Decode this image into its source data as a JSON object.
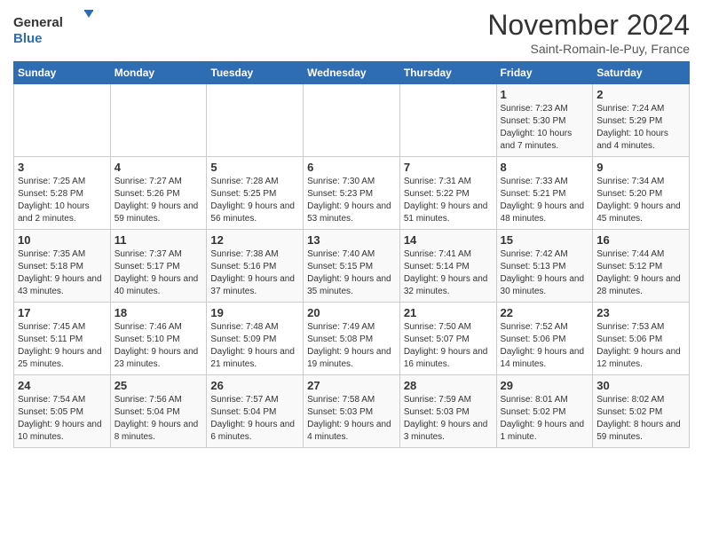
{
  "header": {
    "logo_general": "General",
    "logo_blue": "Blue",
    "month_title": "November 2024",
    "subtitle": "Saint-Romain-le-Puy, France"
  },
  "weekdays": [
    "Sunday",
    "Monday",
    "Tuesday",
    "Wednesday",
    "Thursday",
    "Friday",
    "Saturday"
  ],
  "weeks": [
    [
      {
        "day": "",
        "info": ""
      },
      {
        "day": "",
        "info": ""
      },
      {
        "day": "",
        "info": ""
      },
      {
        "day": "",
        "info": ""
      },
      {
        "day": "",
        "info": ""
      },
      {
        "day": "1",
        "info": "Sunrise: 7:23 AM\nSunset: 5:30 PM\nDaylight: 10 hours and 7 minutes."
      },
      {
        "day": "2",
        "info": "Sunrise: 7:24 AM\nSunset: 5:29 PM\nDaylight: 10 hours and 4 minutes."
      }
    ],
    [
      {
        "day": "3",
        "info": "Sunrise: 7:25 AM\nSunset: 5:28 PM\nDaylight: 10 hours and 2 minutes."
      },
      {
        "day": "4",
        "info": "Sunrise: 7:27 AM\nSunset: 5:26 PM\nDaylight: 9 hours and 59 minutes."
      },
      {
        "day": "5",
        "info": "Sunrise: 7:28 AM\nSunset: 5:25 PM\nDaylight: 9 hours and 56 minutes."
      },
      {
        "day": "6",
        "info": "Sunrise: 7:30 AM\nSunset: 5:23 PM\nDaylight: 9 hours and 53 minutes."
      },
      {
        "day": "7",
        "info": "Sunrise: 7:31 AM\nSunset: 5:22 PM\nDaylight: 9 hours and 51 minutes."
      },
      {
        "day": "8",
        "info": "Sunrise: 7:33 AM\nSunset: 5:21 PM\nDaylight: 9 hours and 48 minutes."
      },
      {
        "day": "9",
        "info": "Sunrise: 7:34 AM\nSunset: 5:20 PM\nDaylight: 9 hours and 45 minutes."
      }
    ],
    [
      {
        "day": "10",
        "info": "Sunrise: 7:35 AM\nSunset: 5:18 PM\nDaylight: 9 hours and 43 minutes."
      },
      {
        "day": "11",
        "info": "Sunrise: 7:37 AM\nSunset: 5:17 PM\nDaylight: 9 hours and 40 minutes."
      },
      {
        "day": "12",
        "info": "Sunrise: 7:38 AM\nSunset: 5:16 PM\nDaylight: 9 hours and 37 minutes."
      },
      {
        "day": "13",
        "info": "Sunrise: 7:40 AM\nSunset: 5:15 PM\nDaylight: 9 hours and 35 minutes."
      },
      {
        "day": "14",
        "info": "Sunrise: 7:41 AM\nSunset: 5:14 PM\nDaylight: 9 hours and 32 minutes."
      },
      {
        "day": "15",
        "info": "Sunrise: 7:42 AM\nSunset: 5:13 PM\nDaylight: 9 hours and 30 minutes."
      },
      {
        "day": "16",
        "info": "Sunrise: 7:44 AM\nSunset: 5:12 PM\nDaylight: 9 hours and 28 minutes."
      }
    ],
    [
      {
        "day": "17",
        "info": "Sunrise: 7:45 AM\nSunset: 5:11 PM\nDaylight: 9 hours and 25 minutes."
      },
      {
        "day": "18",
        "info": "Sunrise: 7:46 AM\nSunset: 5:10 PM\nDaylight: 9 hours and 23 minutes."
      },
      {
        "day": "19",
        "info": "Sunrise: 7:48 AM\nSunset: 5:09 PM\nDaylight: 9 hours and 21 minutes."
      },
      {
        "day": "20",
        "info": "Sunrise: 7:49 AM\nSunset: 5:08 PM\nDaylight: 9 hours and 19 minutes."
      },
      {
        "day": "21",
        "info": "Sunrise: 7:50 AM\nSunset: 5:07 PM\nDaylight: 9 hours and 16 minutes."
      },
      {
        "day": "22",
        "info": "Sunrise: 7:52 AM\nSunset: 5:06 PM\nDaylight: 9 hours and 14 minutes."
      },
      {
        "day": "23",
        "info": "Sunrise: 7:53 AM\nSunset: 5:06 PM\nDaylight: 9 hours and 12 minutes."
      }
    ],
    [
      {
        "day": "24",
        "info": "Sunrise: 7:54 AM\nSunset: 5:05 PM\nDaylight: 9 hours and 10 minutes."
      },
      {
        "day": "25",
        "info": "Sunrise: 7:56 AM\nSunset: 5:04 PM\nDaylight: 9 hours and 8 minutes."
      },
      {
        "day": "26",
        "info": "Sunrise: 7:57 AM\nSunset: 5:04 PM\nDaylight: 9 hours and 6 minutes."
      },
      {
        "day": "27",
        "info": "Sunrise: 7:58 AM\nSunset: 5:03 PM\nDaylight: 9 hours and 4 minutes."
      },
      {
        "day": "28",
        "info": "Sunrise: 7:59 AM\nSunset: 5:03 PM\nDaylight: 9 hours and 3 minutes."
      },
      {
        "day": "29",
        "info": "Sunrise: 8:01 AM\nSunset: 5:02 PM\nDaylight: 9 hours and 1 minute."
      },
      {
        "day": "30",
        "info": "Sunrise: 8:02 AM\nSunset: 5:02 PM\nDaylight: 8 hours and 59 minutes."
      }
    ]
  ]
}
